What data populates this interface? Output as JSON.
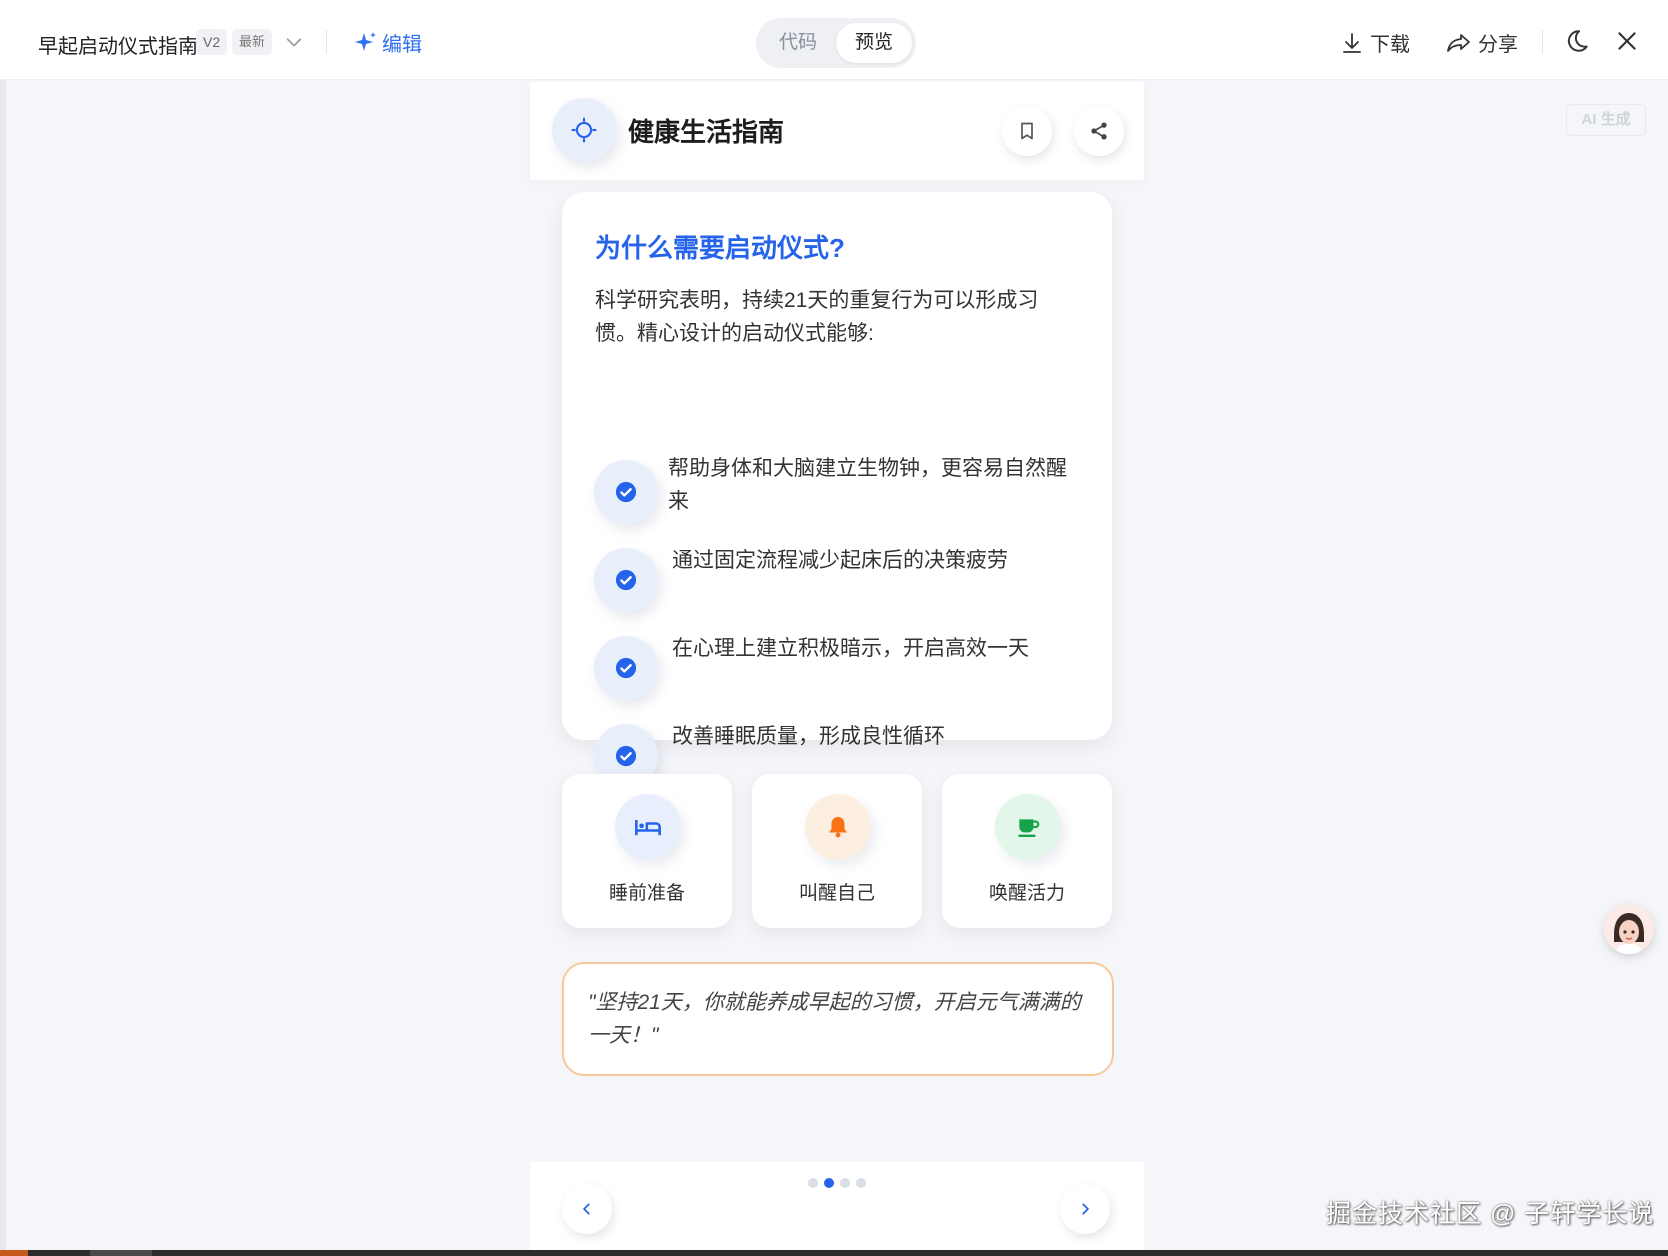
{
  "toolbar": {
    "title": "早起启动仪式指南",
    "version": "V2",
    "version_tag": "最新",
    "edit_label": "编辑",
    "tabs": {
      "code": "代码",
      "preview": "预览"
    },
    "download_label": "下载",
    "share_label": "分享",
    "icons": [
      "chevron-down-icon",
      "sparkle-icon",
      "download-icon",
      "share-icon",
      "moon-icon",
      "close-icon"
    ]
  },
  "ai_tag": "AI 生成",
  "app": {
    "title": "健康生活指南",
    "why": {
      "title": "为什么需要启动仪式?",
      "description": "科学研究表明，持续21天的重复行为可以形成习惯。精心设计的启动仪式能够:",
      "bullets": [
        "帮助身体和大脑建立生物钟，更容易自然醒来",
        "通过固定流程减少起床后的决策疲劳",
        "在心理上建立积极暗示，开启高效一天",
        "改善睡眠质量，形成良性循环"
      ]
    },
    "features": [
      {
        "label": "睡前准备",
        "icon": "bed-icon",
        "color": "#2563eb",
        "bg": "#e8eefc"
      },
      {
        "label": "叫醒自己",
        "icon": "bell-icon",
        "color": "#f97316",
        "bg": "#fdeee2"
      },
      {
        "label": "唤醒活力",
        "icon": "coffee-icon",
        "color": "#16a34a",
        "bg": "#e3f6ea"
      }
    ],
    "quote": "\"坚持21天，你就能养成早起的习惯，开启元气满满的一天！\"",
    "pager": {
      "total": 4,
      "active": 2
    }
  },
  "watermark": "掘金技术社区 @ 子轩学长说",
  "colors": {
    "accent": "#2563eb",
    "quote_border": "#f8c89a"
  }
}
